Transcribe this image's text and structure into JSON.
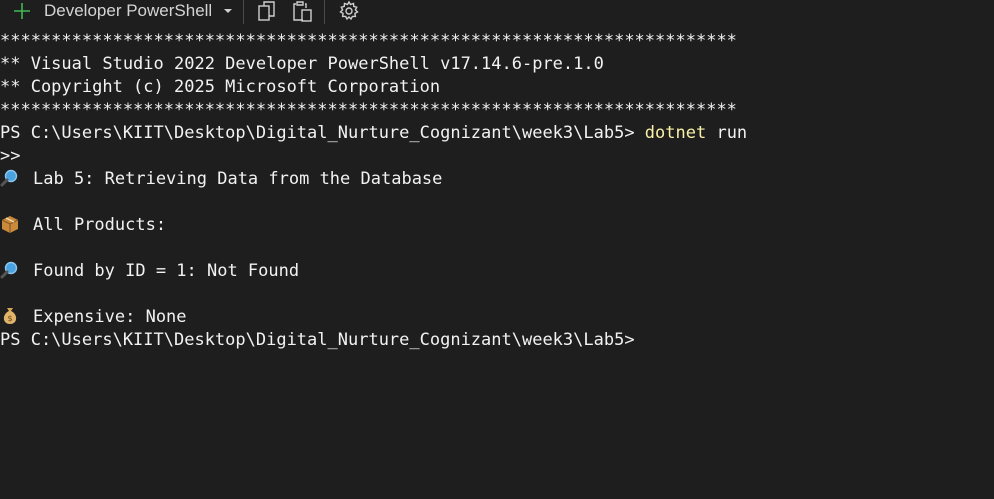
{
  "toolbar": {
    "add_icon": "plus-icon",
    "profile_label": "Developer PowerShell",
    "dropdown_icon": "caret-down-icon",
    "copy_icon": "copy-icon",
    "paste_icon": "paste-icon",
    "settings_icon": "gear-icon"
  },
  "terminal": {
    "banner_border": "************************************************************************",
    "banner_line1": "** Visual Studio 2022 Developer PowerShell v17.14.6-pre.1.0",
    "banner_line2": "** Copyright (c) 2025 Microsoft Corporation",
    "prompt1": "PS C:\\Users\\KIIT\\Desktop\\Digital_Nurture_Cognizant\\week3\\Lab5> ",
    "command_name": "dotnet",
    "command_args": " run",
    "continuation": ">>",
    "output": [
      {
        "icon": "magnifier-icon",
        "text": "Lab 5: Retrieving Data from the Database"
      },
      {
        "icon": "package-icon",
        "text": "All Products:"
      },
      {
        "icon": "magnifier-icon",
        "text": "Found by ID = 1: Not Found"
      },
      {
        "icon": "money-bag-icon",
        "text": "Expensive: None"
      }
    ],
    "prompt2": "PS C:\\Users\\KIIT\\Desktop\\Digital_Nurture_Cognizant\\week3\\Lab5>"
  },
  "colors": {
    "background": "#1e1e1e",
    "foreground": "#f2f2f2",
    "command": "#f9f1a5",
    "accent_green": "#3fb950"
  }
}
